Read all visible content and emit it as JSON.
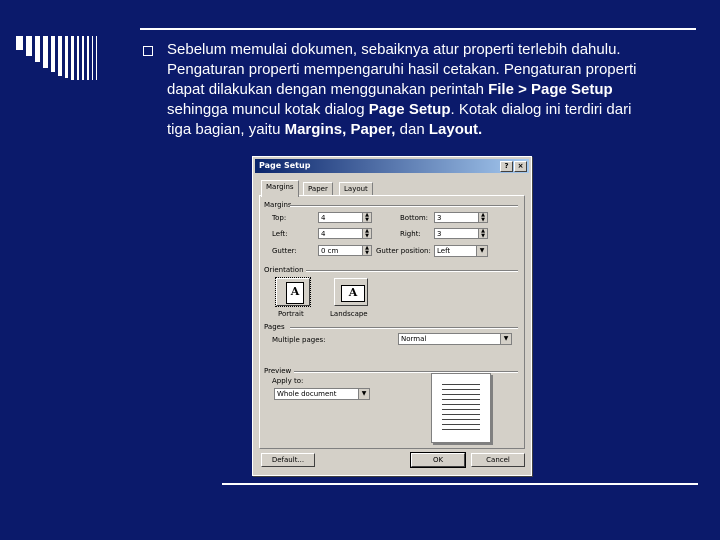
{
  "slide": {
    "bullet_lines": [
      "Sebelum memulai dokumen, sebaiknya atur properti terlebih dahulu.",
      "Pengaturan properti mempengaruhi hasil cetakan. Pengaturan properti",
      "dapat dilakukan dengan menggunakan perintah ",
      "File > Page Setup",
      "sehingga muncul kotak dialog ",
      "Page Setup",
      ". Kotak dialog ini terdiri dari",
      "tiga bagian, yaitu ",
      "Margins, Paper,",
      " dan ",
      "Layout."
    ],
    "colors": {
      "background": "#0b1a6b",
      "text": "#ffffff"
    }
  },
  "dialog": {
    "title": "Page Setup",
    "title_buttons": [
      "?",
      "×"
    ],
    "tabs": [
      "Margins",
      "Paper",
      "Layout"
    ],
    "margins_group": "Margins",
    "top_label": "Top:",
    "top_value": "4",
    "bottom_label": "Bottom:",
    "bottom_value": "3",
    "left_label": "Left:",
    "left_value": "4",
    "right_label": "Right:",
    "right_value": "3",
    "gutter_label": "Gutter:",
    "gutter_value": "0 cm",
    "gutter_pos_label": "Gutter position:",
    "gutter_pos_value": "Left",
    "orientation_group": "Orientation",
    "portrait_label": "Portrait",
    "landscape_label": "Landscape",
    "orient_glyph": "A",
    "pages_group": "Pages",
    "multiple_pages_label": "Multiple pages:",
    "multiple_pages_value": "Normal",
    "preview_group": "Preview",
    "apply_to_label": "Apply to:",
    "apply_to_value": "Whole document",
    "default_button": "Default...",
    "ok_button": "OK",
    "cancel_button": "Cancel"
  }
}
